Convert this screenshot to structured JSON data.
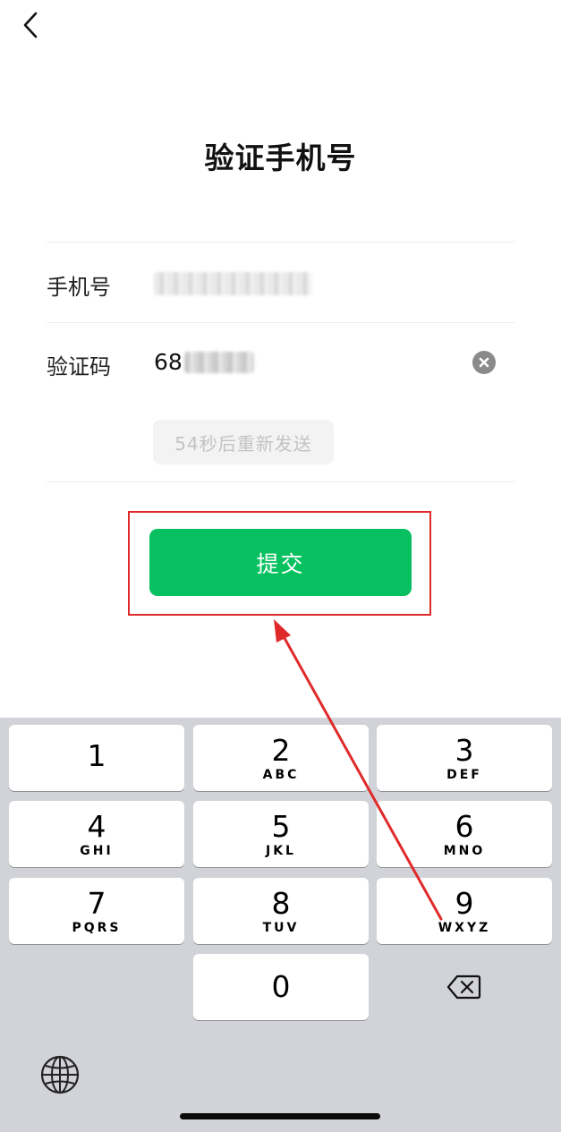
{
  "header": {
    "title": "验证手机号"
  },
  "form": {
    "phone_label": "手机号",
    "code_label": "验证码",
    "code_visible_prefix": "68",
    "resend_label": "54秒后重新发送"
  },
  "submit_label": "提交",
  "keypad": {
    "keys": [
      {
        "digit": "1",
        "letters": ""
      },
      {
        "digit": "2",
        "letters": "ABC"
      },
      {
        "digit": "3",
        "letters": "DEF"
      },
      {
        "digit": "4",
        "letters": "GHI"
      },
      {
        "digit": "5",
        "letters": "JKL"
      },
      {
        "digit": "6",
        "letters": "MNO"
      },
      {
        "digit": "7",
        "letters": "PQRS"
      },
      {
        "digit": "8",
        "letters": "TUV"
      },
      {
        "digit": "9",
        "letters": "WXYZ"
      },
      {
        "digit": "0",
        "letters": ""
      }
    ]
  },
  "icons": {
    "back": "chevron-left-icon",
    "clear": "clear-icon",
    "delete": "backspace-icon",
    "globe": "globe-icon"
  },
  "colors": {
    "accent": "#07c160",
    "annotation": "#e02a2a",
    "keyboard_bg": "#d1d3d9"
  }
}
